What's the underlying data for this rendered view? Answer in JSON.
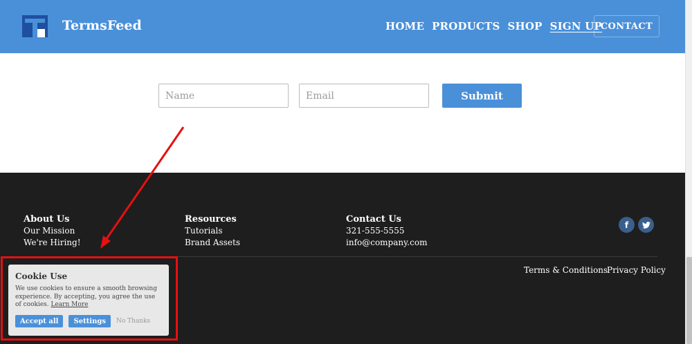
{
  "header": {
    "brand": "TermsFeed",
    "nav": [
      "HOME",
      "PRODUCTS",
      "SHOP",
      "SIGN UP"
    ],
    "contact": "CONTACT"
  },
  "form": {
    "name_placeholder": "Name",
    "email_placeholder": "Email",
    "submit": "Submit"
  },
  "footer": {
    "about": {
      "title": "About Us",
      "links": [
        "Our Mission",
        "We're Hiring!"
      ]
    },
    "resources": {
      "title": "Resources",
      "links": [
        "Tutorials",
        "Brand Assets"
      ]
    },
    "contact": {
      "title": "Contact Us",
      "phone": "321-555-5555",
      "email": "info@company.com"
    },
    "legal": [
      "Terms & Conditions",
      "Privacy Policy"
    ]
  },
  "cookie": {
    "title": "Cookie Use",
    "text": "We use cookies to ensure a smooth browsing experience. By accepting, you agree the use of cookies.",
    "learn_more": "Learn More",
    "accept": "Accept all",
    "settings": "Settings",
    "no_thanks": "No Thanks"
  },
  "colors": {
    "brand_blue": "#4a90d9",
    "footer_bg": "#1e1e1e",
    "annotation_red": "#e51010"
  }
}
